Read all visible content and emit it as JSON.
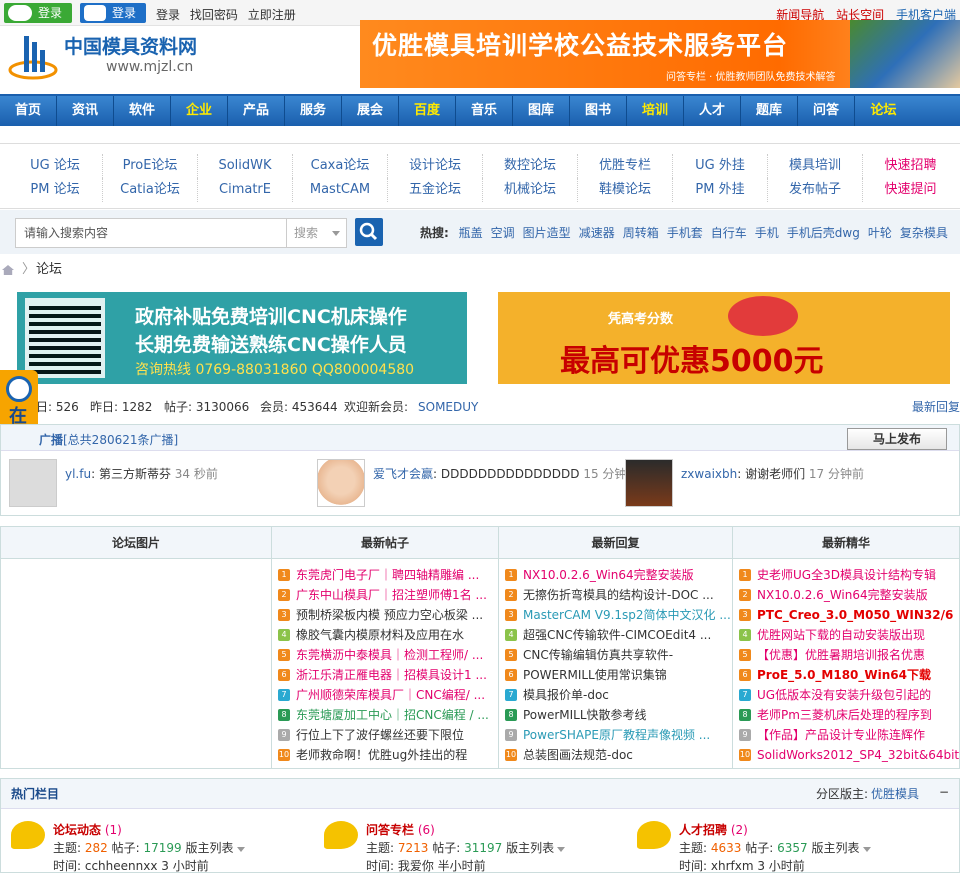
{
  "topbar": {
    "wechat_login": "登录",
    "qq_login": "登录",
    "login": "登录",
    "find_password": "找回密码",
    "register": "立即注册",
    "links": [
      "新闻导航",
      "站长空间",
      "手机客户端"
    ]
  },
  "logo": {
    "name": "中国模具资料网",
    "url": "www.mjzl.cn"
  },
  "banner": {
    "title": "优胜模具培训学校公益技术服务平台",
    "subtitle": "问答专栏 · 优胜教师团队免费技术解答"
  },
  "nav": [
    {
      "label": "首页",
      "hl": false
    },
    {
      "label": "资讯",
      "hl": false
    },
    {
      "label": "软件",
      "hl": false
    },
    {
      "label": "企业",
      "hl": true
    },
    {
      "label": "产品",
      "hl": false
    },
    {
      "label": "服务",
      "hl": false
    },
    {
      "label": "展会",
      "hl": false
    },
    {
      "label": "百度",
      "hl": true
    },
    {
      "label": "音乐",
      "hl": false
    },
    {
      "label": "图库",
      "hl": false
    },
    {
      "label": "图书",
      "hl": false
    },
    {
      "label": "培训",
      "hl": true
    },
    {
      "label": "人才",
      "hl": false
    },
    {
      "label": "题库",
      "hl": false
    },
    {
      "label": "问答",
      "hl": false
    },
    {
      "label": "论坛",
      "hl": true
    }
  ],
  "subnav": {
    "row1": [
      "UG 论坛",
      "ProE论坛",
      "SolidWK",
      "Caxa论坛",
      "设计论坛",
      "数控论坛",
      "优胜专栏",
      "UG 外挂",
      "模具培训",
      "快速招聘"
    ],
    "row2": [
      "PM 论坛",
      "Catia论坛",
      "CimatrE",
      "MastCAM",
      "五金论坛",
      "机械论坛",
      "鞋模论坛",
      "PM 外挂",
      "发布帖子",
      "快速提问"
    ]
  },
  "search": {
    "placeholder": "请输入搜索内容",
    "select": "搜索",
    "hot_label": "热搜:",
    "hot": [
      "瓶盖",
      "空调",
      "图片造型",
      "减速器",
      "周转箱",
      "手机套",
      "自行车",
      "手机",
      "手机后壳dwg",
      "叶轮",
      "复杂模具"
    ]
  },
  "breadcrumb": {
    "current": "论坛"
  },
  "ads": {
    "ad1_line1": "政府补贴免费培训CNC机床操作",
    "ad1_line2": "长期免费输送熟练CNC操作人员",
    "ad1_line3": "咨询热线 0769-88031860 QQ800004580",
    "ad2_tag": "凭高考分数",
    "ad2_text": "最高可优惠5000元"
  },
  "stats": {
    "today": "日: 526",
    "yesterday": "昨日: 1282",
    "posts": "帖子: 3130066",
    "members": "会员: 453644",
    "welcome": "欢迎新会员: ",
    "new_member": "SOMEDUY",
    "latest": "最新回复"
  },
  "broadcast": {
    "title": "广播",
    "total": "[总共280621条广播]",
    "post_button": "马上发布",
    "items": [
      {
        "user": "yl.fu",
        "text": ": 第三方斯蒂芬",
        "time": "34 秒前"
      },
      {
        "user": "爱飞才会赢",
        "text": ": DDDDDDDDDDDDDDD",
        "time": "15 分钟前"
      },
      {
        "user": "zxwaixbh",
        "text": ": 谢谢老师们",
        "time": "17 分钟前"
      }
    ]
  },
  "side_tab": {
    "label": "在线咨询"
  },
  "columns": {
    "pics": {
      "title": "论坛图片"
    },
    "new_posts": {
      "title": "最新帖子",
      "items": [
        {
          "n": "1",
          "text": "东莞虎门电子厂｜聘四轴精雕编 ...",
          "color": "#e3006d"
        },
        {
          "n": "2",
          "text": "广东中山模具厂｜招注塑师傅1名 ...",
          "color": "#e3006d"
        },
        {
          "n": "3",
          "text": "预制桥梁板内模 预应力空心板梁 ...",
          "color": "#333"
        },
        {
          "n": "4",
          "text": "橡胶气囊内模原材料及应用在水",
          "color": "#333"
        },
        {
          "n": "5",
          "text": "东莞横沥中泰模具｜检测工程师/ ...",
          "color": "#e3006d"
        },
        {
          "n": "6",
          "text": "浙江乐清正雁电器｜招模具设计1 ...",
          "color": "#e3006d"
        },
        {
          "n": "7",
          "text": "广州顺德荣库模具厂｜CNC编程/ ...",
          "color": "#e3006d"
        },
        {
          "n": "8",
          "text": "东莞塘厦加工中心｜招CNC编程 / ...",
          "color": "#2a9a55"
        },
        {
          "n": "9",
          "text": "行位上下了波仔螺丝还要下限位",
          "color": "#333"
        },
        {
          "n": "10",
          "text": "老师救命啊！优胜ug外挂出的程",
          "color": "#333"
        }
      ]
    },
    "new_replies": {
      "title": "最新回复",
      "items": [
        {
          "n": "1",
          "text": "NX10.0.2.6_Win64完整安装版",
          "color": "#e3006d"
        },
        {
          "n": "2",
          "text": "无擦伤折弯模具的结构设计-DOC ...",
          "color": "#333"
        },
        {
          "n": "3",
          "text": "MasterCAM V9.1sp2简体中文汉化 ...",
          "color": "#2a9ab5"
        },
        {
          "n": "4",
          "text": "超强CNC传输软件-CIMCOEdit4 ...",
          "color": "#333"
        },
        {
          "n": "5",
          "text": "CNC传输编辑仿真共享软件-",
          "color": "#333"
        },
        {
          "n": "6",
          "text": "POWERMILL使用常识集锦",
          "color": "#333"
        },
        {
          "n": "7",
          "text": "模具报价单-doc",
          "color": "#333"
        },
        {
          "n": "8",
          "text": "PowerMILL快散参考线",
          "color": "#333"
        },
        {
          "n": "9",
          "text": "PowerSHAPE原厂教程声像视频 ...",
          "color": "#2a9ab5"
        },
        {
          "n": "10",
          "text": "总装图画法规范-doc",
          "color": "#333"
        }
      ]
    },
    "featured": {
      "title": "最新精华",
      "items": [
        {
          "n": "1",
          "text": "史老师UG全3D模具设计结构专辑",
          "color": "#e3006d",
          "bold": false
        },
        {
          "n": "2",
          "text": "NX10.0.2.6_Win64完整安装版",
          "color": "#e3006d",
          "bold": false
        },
        {
          "n": "3",
          "text": "PTC_Creo_3.0_M050_WIN32/6",
          "color": "#e30000",
          "bold": true
        },
        {
          "n": "4",
          "text": "优胜网站下载的自动安装版出现",
          "color": "#e3006d",
          "bold": false
        },
        {
          "n": "5",
          "text": "【优惠】优胜暑期培训报名优惠",
          "color": "#e3006d",
          "bold": false
        },
        {
          "n": "6",
          "text": "ProE_5.0_M180_Win64下载",
          "color": "#e30000",
          "bold": true
        },
        {
          "n": "7",
          "text": "UG低版本没有安装升级包引起的",
          "color": "#e3006d",
          "bold": false
        },
        {
          "n": "8",
          "text": "老师Pm三菱机床后处理的程序到",
          "color": "#e3006d",
          "bold": false
        },
        {
          "n": "9",
          "text": "【作品】产品设计专业陈连辉作",
          "color": "#e3006d",
          "bold": false
        },
        {
          "n": "10",
          "text": "SolidWorks2012_SP4_32bit&64bit ...",
          "color": "#e3006d",
          "bold": false
        }
      ]
    }
  },
  "hot_section": {
    "title": "热门栏目",
    "moderator_label": "分区版主:",
    "moderator": "优胜模具",
    "collapse": "−",
    "items": [
      {
        "name": "论坛动态",
        "count": "(1)",
        "topics_label": "主题:",
        "topics": "282",
        "posts_label": "帖子:",
        "posts": "17199",
        "mods": "版主列表",
        "time": "时间: cchheennxx 3 小时前"
      },
      {
        "name": "问答专栏",
        "count": "(6)",
        "topics_label": "主题:",
        "topics": "7213",
        "posts_label": "帖子:",
        "posts": "31197",
        "mods": "版主列表",
        "time": "时间: 我爱你 半小时前"
      },
      {
        "name": "人才招聘",
        "count": "(2)",
        "topics_label": "主题:",
        "topics": "4633",
        "posts_label": "帖子:",
        "posts": "6357",
        "mods": "版主列表",
        "time": "时间: xhrfxm 3 小时前"
      }
    ]
  }
}
